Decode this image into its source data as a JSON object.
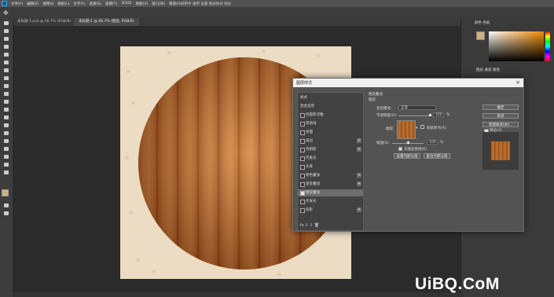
{
  "app": {
    "window_title": "试用中 通用 设置 图层样式 图标",
    "menus": [
      "文件(F)",
      "编辑(E)",
      "图像(I)",
      "图层(L)",
      "文字(Y)",
      "选择(S)",
      "滤镜(T)",
      "3D(D)",
      "视图(V)",
      "窗口(W)",
      "帮助(H)"
    ]
  },
  "tabs": [
    {
      "label": "未标题-1.psd @ 66.7% (RGB/8)"
    },
    {
      "label": "未标题-1 @ 66.7% (图层, RGB/8)"
    }
  ],
  "right_panel": {
    "color_tabs": "颜色   色板",
    "layers_tabs": "图层   通道   路径"
  },
  "dialog": {
    "title": "图层样式",
    "close": "×",
    "style_list": [
      {
        "label": "样式",
        "checkbox": false,
        "plus": false,
        "header": true
      },
      {
        "label": "混合选项",
        "checkbox": false,
        "plus": false,
        "header": true
      },
      {
        "label": "斜面和浮雕",
        "checkbox": true,
        "checked": false,
        "plus": false
      },
      {
        "label": "等高线",
        "checkbox": true,
        "checked": false,
        "plus": false
      },
      {
        "label": "纹理",
        "checkbox": true,
        "checked": false,
        "plus": false
      },
      {
        "label": "描边",
        "checkbox": true,
        "checked": false,
        "plus": true
      },
      {
        "label": "内阴影",
        "checkbox": true,
        "checked": false,
        "plus": true
      },
      {
        "label": "内发光",
        "checkbox": true,
        "checked": false,
        "plus": false
      },
      {
        "label": "光泽",
        "checkbox": true,
        "checked": false,
        "plus": false
      },
      {
        "label": "颜色叠加",
        "checkbox": true,
        "checked": false,
        "plus": true
      },
      {
        "label": "渐变叠加",
        "checkbox": true,
        "checked": false,
        "plus": true
      },
      {
        "label": "图案叠加",
        "checkbox": true,
        "checked": true,
        "plus": false,
        "selected": true
      },
      {
        "label": "外发光",
        "checkbox": true,
        "checked": false,
        "plus": false
      },
      {
        "label": "投影",
        "checkbox": true,
        "checked": false,
        "plus": true
      }
    ],
    "list_tools": "fx  ⇧  ⇩          🗑",
    "section_title": "图案叠加",
    "section_sub": "图案",
    "blend_mode_label": "混合模式:",
    "blend_mode_value": "正常",
    "opacity_label": "不透明度(O):",
    "opacity_value": "100",
    "opacity_unit": "%",
    "opacity_level": 1.0,
    "pattern_label": "图案:",
    "snap_label": "贴紧原点(A)",
    "scale_label": "缩放(S):",
    "scale_value": "100",
    "scale_unit": "%",
    "scale_level": 0.5,
    "link_label": "与图层链接(K)",
    "set_default": "设置为默认值",
    "reset_default": "复位为默认值",
    "ok": "确定",
    "cancel": "取消",
    "new_style": "新建样式(W)...",
    "preview_label": "预览(V)"
  },
  "watermark": "UiBQ.CoM",
  "colors": {
    "foreground": "#d2b07c",
    "canvas_bg": "#ebdcc3",
    "wood": "#c67a3a"
  }
}
